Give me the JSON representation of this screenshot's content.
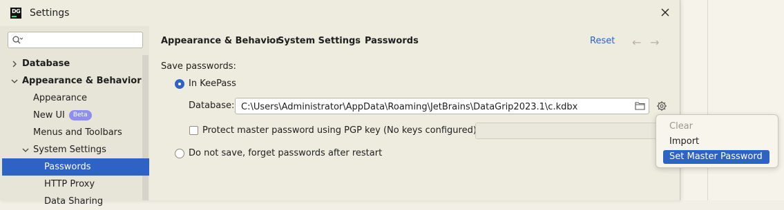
{
  "window": {
    "title": "Settings",
    "app_icon_text": "DG"
  },
  "search": {
    "placeholder": "",
    "value": ""
  },
  "sidebar": {
    "items": [
      {
        "label": "Database",
        "expanded": false
      },
      {
        "label": "Appearance & Behavior",
        "expanded": true
      },
      {
        "label": "Appearance"
      },
      {
        "label": "New UI",
        "badge": "Beta"
      },
      {
        "label": "Menus and Toolbars"
      },
      {
        "label": "System Settings",
        "expanded": true
      },
      {
        "label": "Passwords",
        "selected": true
      },
      {
        "label": "HTTP Proxy"
      },
      {
        "label": "Data Sharing"
      }
    ]
  },
  "breadcrumb": {
    "items": [
      "Appearance & Behavior",
      "System Settings",
      "Passwords"
    ],
    "separator": "›"
  },
  "header": {
    "reset_label": "Reset",
    "back_icon": "←",
    "forward_icon": "→"
  },
  "content": {
    "save_passwords_label": "Save passwords:",
    "option_keepass": "In KeePass",
    "database_label": "Database:",
    "database_path": "C:\\Users\\Administrator\\AppData\\Roaming\\JetBrains\\DataGrip2023.1\\c.kdbx",
    "pgp_label": "Protect master password using PGP key (No keys configured)",
    "pgp_value": "",
    "option_no_save": "Do not save, forget passwords after restart"
  },
  "gear_menu": {
    "items": [
      {
        "label": "Clear",
        "disabled": true
      },
      {
        "label": "Import"
      },
      {
        "label": "Set Master Password",
        "selected": true
      }
    ]
  },
  "colors": {
    "accent": "#2f62c5",
    "link": "#2a5fcf",
    "badge": "#8e8ef0",
    "panel_bg": "#eeecdf"
  }
}
